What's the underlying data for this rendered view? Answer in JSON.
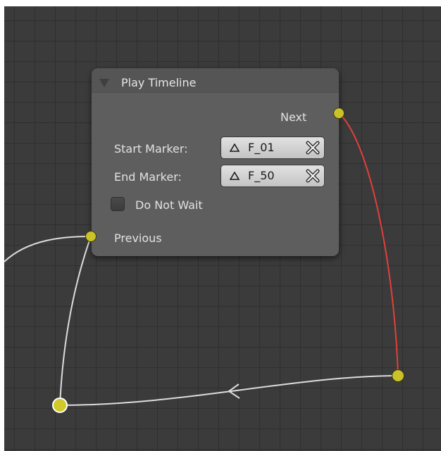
{
  "node": {
    "title": "Play Timeline",
    "output_socket_label": "Next",
    "input_socket_label": "Previous",
    "start_marker": {
      "label": "Start Marker:",
      "value": "F_01"
    },
    "end_marker": {
      "label": "End Marker:",
      "value": "F_50"
    },
    "do_not_wait": {
      "label": "Do Not Wait",
      "checked": false
    }
  },
  "icons": {
    "collapse": "collapse-triangle-icon",
    "marker": "marker-triangle-icon",
    "clear": "clear-x-icon"
  },
  "colors": {
    "background": "#3b3b3b",
    "grid": "#2f2f2f",
    "node_body": "#5e5e5e",
    "node_header": "#555555",
    "socket": "#c9c22a",
    "link_selected": "#e0403a",
    "link_normal": "#dcdcdc"
  }
}
